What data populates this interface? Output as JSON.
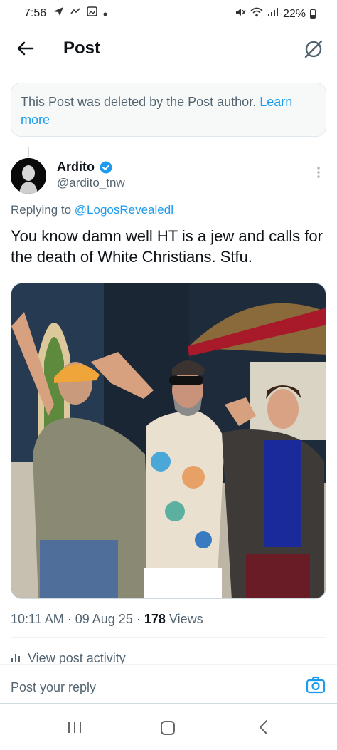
{
  "status_bar": {
    "time": "7:56",
    "left_icons": [
      "send-icon",
      "missed-call-icon",
      "gallery-icon",
      "dot-icon"
    ],
    "right_icons": [
      "mute-icon",
      "wifi-icon",
      "signal-icon"
    ],
    "battery_text": "22%"
  },
  "header": {
    "title": "Post"
  },
  "deleted_notice": {
    "text": "This Post was deleted by the Post author.",
    "link": "Learn more"
  },
  "post": {
    "author_name": "Ardito",
    "handle": "@ardito_tnw",
    "verified": true,
    "replying_prefix": "Replying to",
    "replying_to": "@LogosRevealedl",
    "text": "You know damn well HT is a jew and calls for the death of White Christians. Stfu.",
    "time": "10:11 AM",
    "date": "09 Aug 25",
    "views_count": "178",
    "views_label": "Views",
    "activity_label": "View post activity"
  },
  "reply": {
    "placeholder": "Post your reply"
  },
  "colors": {
    "accent": "#1d9bf0",
    "secondary_text": "#536471",
    "primary_text": "#0f1419"
  }
}
